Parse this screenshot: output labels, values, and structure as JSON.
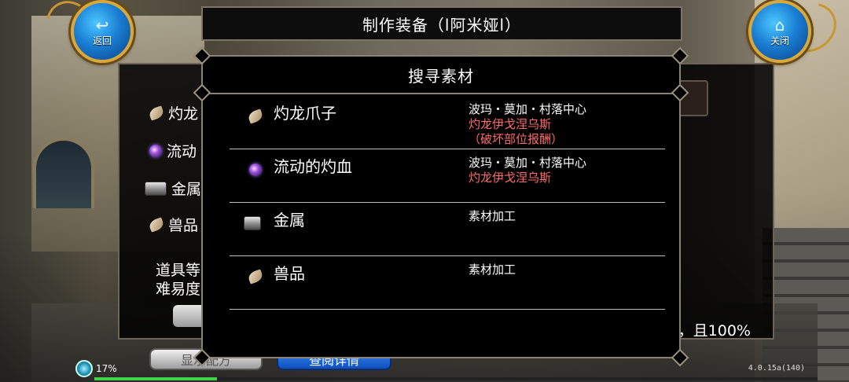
{
  "top_left_button": {
    "label": "返回",
    "icon": "return-arrow-icon"
  },
  "top_right_button": {
    "label": "关闭",
    "icon": "home-icon"
  },
  "title": "制作装备（l阿米娅l）",
  "back_panel": {
    "items": [
      {
        "label": "灼龙",
        "icon": "claw-icon"
      },
      {
        "label": "流动",
        "icon": "orb-icon"
      },
      {
        "label": "金属",
        "icon": "ingot-icon"
      },
      {
        "label": "兽品",
        "icon": "claw-icon"
      }
    ],
    "text_line1": "道具等",
    "text_line2": "难易度",
    "right_text": "，且100%"
  },
  "bottom_buttons": {
    "gray": "显示配方",
    "blue": "查阅详情"
  },
  "status": {
    "percent": "17%",
    "exp_fill": 0.17,
    "version": "4.0.15a(140)"
  },
  "modal": {
    "title": "搜寻素材",
    "rows": [
      {
        "name": "灼龙爪子",
        "icon": "claw-icon",
        "sources": [
          {
            "text": "波玛・莫加・村落中心",
            "color": "white"
          },
          {
            "text": "灼龙伊戈涅乌斯",
            "color": "red"
          },
          {
            "text": "（破坏部位报酬）",
            "color": "red"
          }
        ]
      },
      {
        "name": "流动的灼血",
        "icon": "orb-icon",
        "sources": [
          {
            "text": "波玛・莫加・村落中心",
            "color": "white"
          },
          {
            "text": "灼龙伊戈涅乌斯",
            "color": "red"
          }
        ]
      },
      {
        "name": "金属",
        "icon": "ingot-icon",
        "sources": [
          {
            "text": "素材加工",
            "color": "white"
          }
        ]
      },
      {
        "name": "兽品",
        "icon": "claw-icon",
        "sources": [
          {
            "text": "素材加工",
            "color": "white"
          }
        ]
      }
    ]
  }
}
